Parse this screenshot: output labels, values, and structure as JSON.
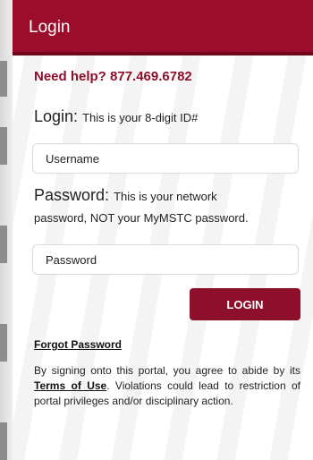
{
  "header": {
    "title": "Login"
  },
  "help": {
    "text": "Need help? 877.469.6782"
  },
  "login_field": {
    "label": "Login:",
    "hint": "This is your 8-digit ID#",
    "placeholder": "Username"
  },
  "password_field": {
    "label": "Password:",
    "hint_line1": "This is your network",
    "hint_line2": "password, NOT your MyMSTC password.",
    "placeholder": "Password"
  },
  "actions": {
    "login_label": "LOGIN",
    "forgot_label": "Forgot Password"
  },
  "terms": {
    "prefix": "By signing onto this portal, you agree to abide by its",
    "link_label": "Terms of Use",
    "suffix": ". Violations could lead to restriction of portal privileges and/or disciplinary action."
  },
  "colors": {
    "brand": "#9b0d2a",
    "button": "#8e0f2b"
  }
}
